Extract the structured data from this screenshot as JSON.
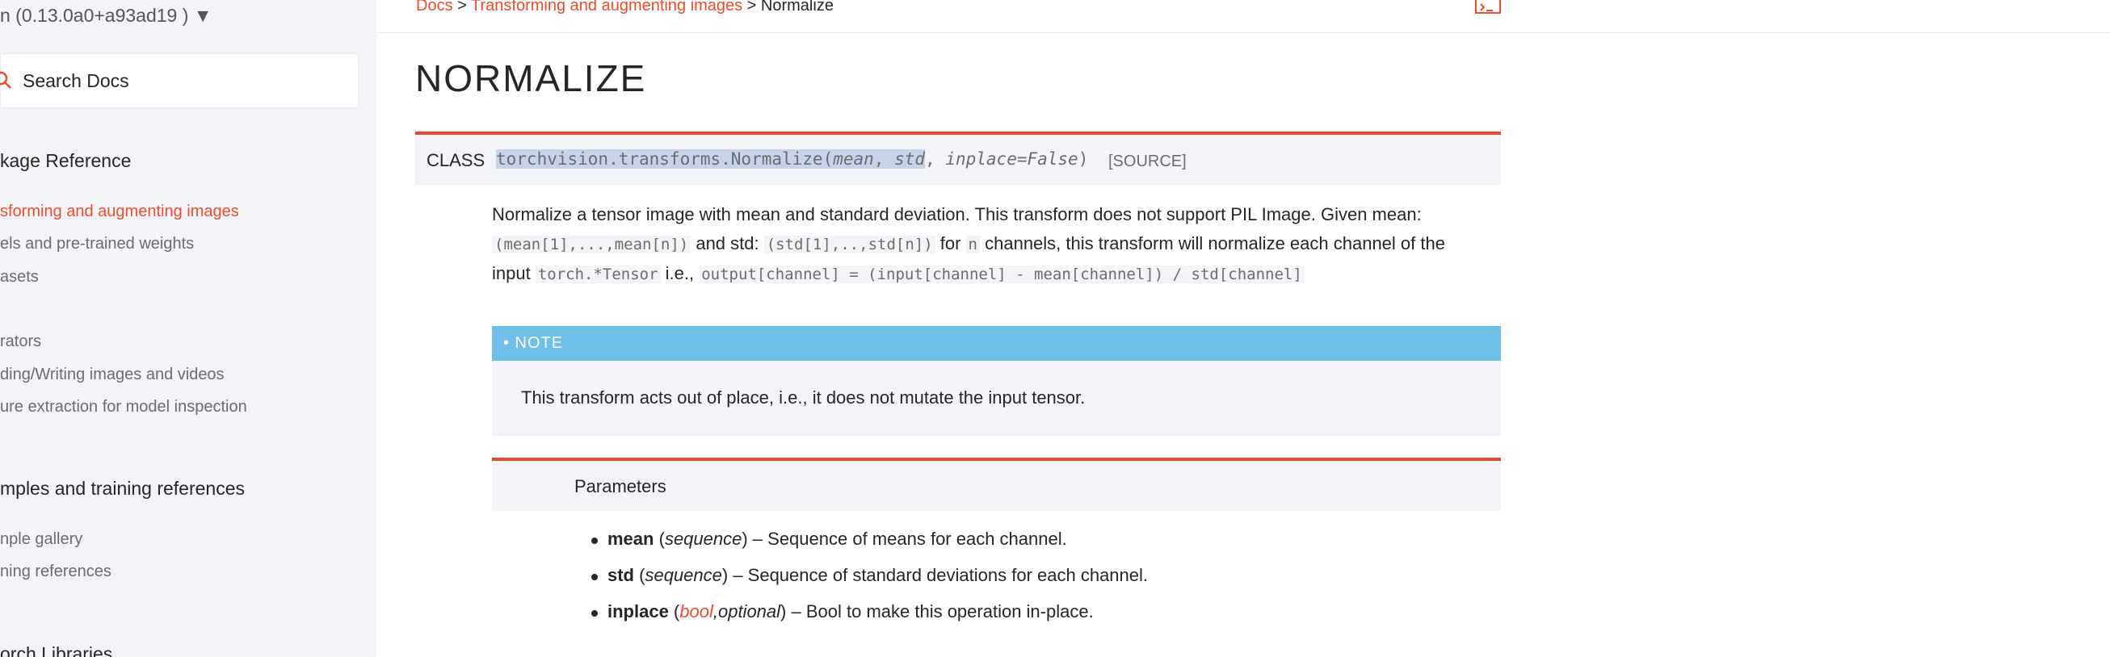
{
  "sidebar": {
    "version": "n (0.13.0a0+a93ad19 ) ▼",
    "search_placeholder": "Search Docs",
    "sections": [
      {
        "heading": "kage Reference",
        "items": [
          {
            "label": "sforming and augmenting images",
            "active": true
          },
          {
            "label": "els and pre-trained weights"
          },
          {
            "label": "asets"
          }
        ]
      },
      {
        "heading": "",
        "items": [
          {
            "label": "rators"
          },
          {
            "label": "ding/Writing images and videos"
          },
          {
            "label": "ure extraction for model inspection"
          }
        ]
      },
      {
        "heading": "mples and training references",
        "items": [
          {
            "label": "nple gallery"
          },
          {
            "label": "ning references"
          }
        ]
      },
      {
        "heading": "orch Libraries",
        "items": []
      }
    ]
  },
  "breadcrumb": {
    "root": "Docs",
    "sep": " > ",
    "parent": "Transforming and augmenting images",
    "current": "Normalize"
  },
  "page": {
    "title": "NORMALIZE"
  },
  "signature": {
    "kind": "CLASS",
    "name": "torchvision.transforms.Normalize(",
    "arg1": "mean",
    "comma1": ", ",
    "arg2": "std",
    "comma2": ", ",
    "arg3": "inplace=False",
    "close": ")",
    "source": "[SOURCE]"
  },
  "description": {
    "line1": "Normalize a tensor image with mean and standard deviation. This transform does not support PIL Image. Given mean:",
    "mean_code": "(mean[1],...,mean[n])",
    "and_std": " and std: ",
    "std_code": "(std[1],..,std[n])",
    "for_text": " for ",
    "n_code": "n",
    "channels_text": " channels, this transform will normalize each channel of the",
    "input_text": "input ",
    "tensor_code": "torch.*Tensor",
    "ie_text": " i.e., ",
    "formula_code": "output[channel] = (input[channel] - mean[channel]) / std[channel]"
  },
  "note": {
    "label": "• NOTE",
    "text": "This transform acts out of place, i.e., it does not mutate the input tensor."
  },
  "parameters": {
    "heading": "Parameters",
    "items": [
      {
        "name": "mean",
        "open": " (",
        "type": "sequence",
        "close": ")",
        "desc": " – Sequence of means for each channel."
      },
      {
        "name": "std",
        "open": " (",
        "type": "sequence",
        "close": ")",
        "desc": " – Sequence of standard deviations for each channel."
      },
      {
        "name": "inplace",
        "open": " (",
        "type_link": "bool",
        "type2": ",optional",
        "close": ")",
        "desc": " – Bool to make this operation in-place."
      }
    ]
  },
  "colors": {
    "accent": "#ee4c2c",
    "note_blue": "#6ec0e8",
    "sidebar_bg": "#f3f4f7"
  }
}
